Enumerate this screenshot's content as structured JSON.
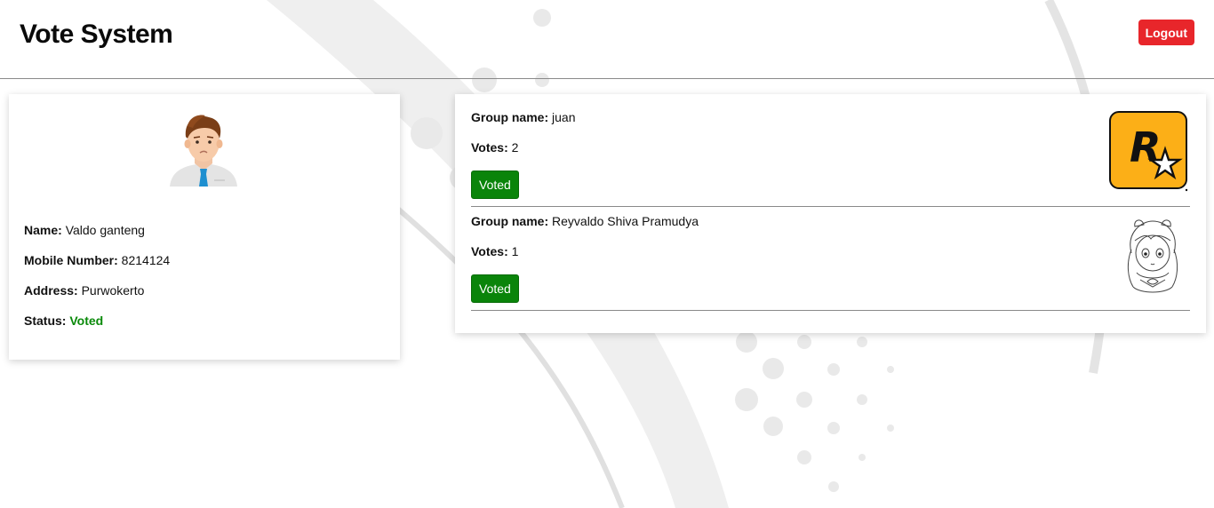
{
  "app": {
    "title": "Vote System",
    "logout_label": "Logout"
  },
  "profile": {
    "avatar_icon": "man-avatar-icon",
    "name_label": "Name:",
    "name_value": "Valdo ganteng",
    "mobile_label": "Mobile Number:",
    "mobile_value": "8214124",
    "address_label": "Address:",
    "address_value": "Purwokerto",
    "status_label": "Status:",
    "status_value": "Voted"
  },
  "groups": [
    {
      "group_label": "Group name:",
      "group_name": "juan",
      "votes_label": "Votes:",
      "votes": "2",
      "button_label": "Voted",
      "logo_icon": "rockstar-logo-icon"
    },
    {
      "group_label": "Group name:",
      "group_name": "Reyvaldo Shiva Pramudya",
      "votes_label": "Votes:",
      "votes": "1",
      "button_label": "Voted",
      "logo_icon": "anime-girl-sketch-icon"
    }
  ],
  "colors": {
    "logout": "#e8262b",
    "voted_button": "#0a840a",
    "status_voted": "#0a8a0a",
    "rockstar_bg": "#fcaf17"
  }
}
